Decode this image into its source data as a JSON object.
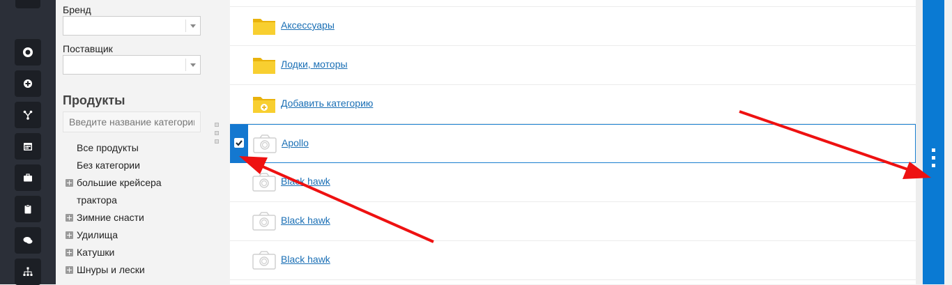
{
  "rail": {
    "icons": [
      "lifebuoy-icon",
      "plus-circle-icon",
      "fork-icon",
      "calendar-icon",
      "briefcase-icon",
      "clipboard-icon",
      "chat-icon",
      "sitemap-icon"
    ]
  },
  "filters": {
    "brand_label": "Бренд",
    "brand_value": "",
    "supplier_label": "Поставщик",
    "supplier_value": "",
    "products_title": "Продукты",
    "search_placeholder": "Введите название категории",
    "categories": [
      {
        "label": "Все продукты",
        "expandable": false
      },
      {
        "label": "Без категории",
        "expandable": false
      },
      {
        "label": "большие крейсера",
        "expandable": true
      },
      {
        "label": "трактора",
        "expandable": false
      },
      {
        "label": "Зимние снасти",
        "expandable": true
      },
      {
        "label": "Удилища",
        "expandable": true
      },
      {
        "label": "Катушки",
        "expandable": true
      },
      {
        "label": "Шнуры и лески",
        "expandable": true
      }
    ]
  },
  "list": {
    "rows": [
      {
        "label": "Аксессуары",
        "type": "folder",
        "selected": false
      },
      {
        "label": "Лодки, моторы",
        "type": "folder",
        "selected": false
      },
      {
        "label": "Добавить категорию",
        "type": "folder-add",
        "selected": false
      },
      {
        "label": "Apollo",
        "type": "product",
        "selected": true
      },
      {
        "label": "Black hawk",
        "type": "product",
        "selected": false
      },
      {
        "label": "Black hawk",
        "type": "product",
        "selected": false
      },
      {
        "label": "Black hawk",
        "type": "product",
        "selected": false
      }
    ]
  },
  "colors": {
    "accent": "#0a7ad3",
    "link": "#1a6fb5",
    "annotation_arrow": "#ee1111",
    "folder": "#f5c518"
  }
}
